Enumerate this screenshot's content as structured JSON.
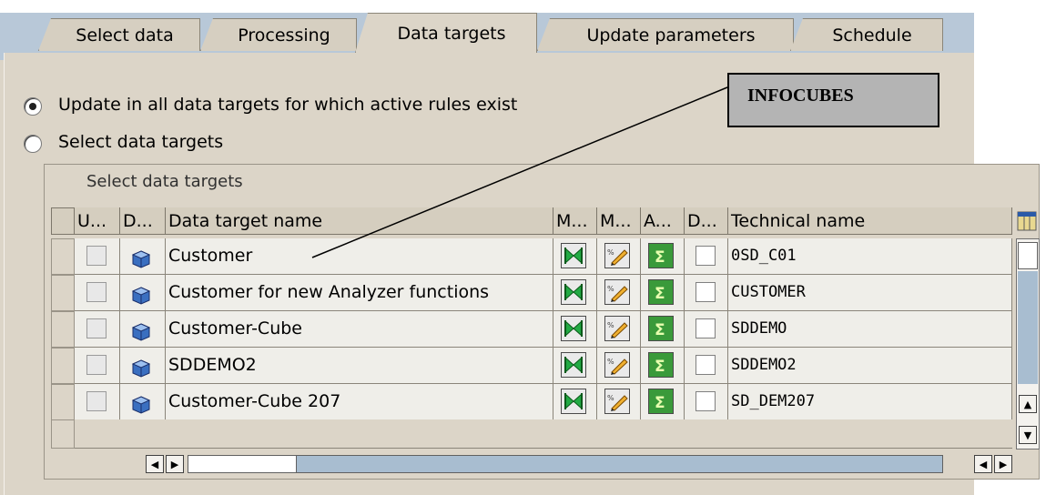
{
  "tabs": [
    "Select data",
    "Processing",
    "Data targets",
    "Update parameters",
    "Schedule"
  ],
  "active_tab": "Data targets",
  "radio_options": [
    {
      "label": "Update in all data targets for which active rules exist",
      "selected": true
    },
    {
      "label": "Select data targets",
      "selected": false
    }
  ],
  "annotation": {
    "label": "INFOCUBES"
  },
  "group": {
    "title": "Select data targets"
  },
  "table": {
    "headers": [
      "U...",
      "D...",
      "Data target name",
      "M...",
      "M...",
      "A...",
      "D...",
      "Technical name"
    ],
    "rows": [
      {
        "name": "Customer",
        "technical": "0SD_C01"
      },
      {
        "name": "Customer for new Analyzer functions",
        "technical": "CUSTOMER"
      },
      {
        "name": "Customer-Cube",
        "technical": "SDDEMO"
      },
      {
        "name": "SDDEMO2",
        "technical": "SDDEMO2"
      },
      {
        "name": "Customer-Cube 207",
        "technical": "SD_DEM207"
      }
    ]
  },
  "icons": {
    "target_type": "infocube-icon",
    "col_m1": "bowtie-icon",
    "col_m2": "pencil-icon",
    "col_a": "sigma-icon",
    "settings": "column-settings-icon"
  },
  "colors": {
    "tab_bar": "#b8c8d8",
    "panel": "#dcd5c8",
    "scroll_track": "#a8bdd0",
    "icon_green": "#2f8a2f"
  }
}
